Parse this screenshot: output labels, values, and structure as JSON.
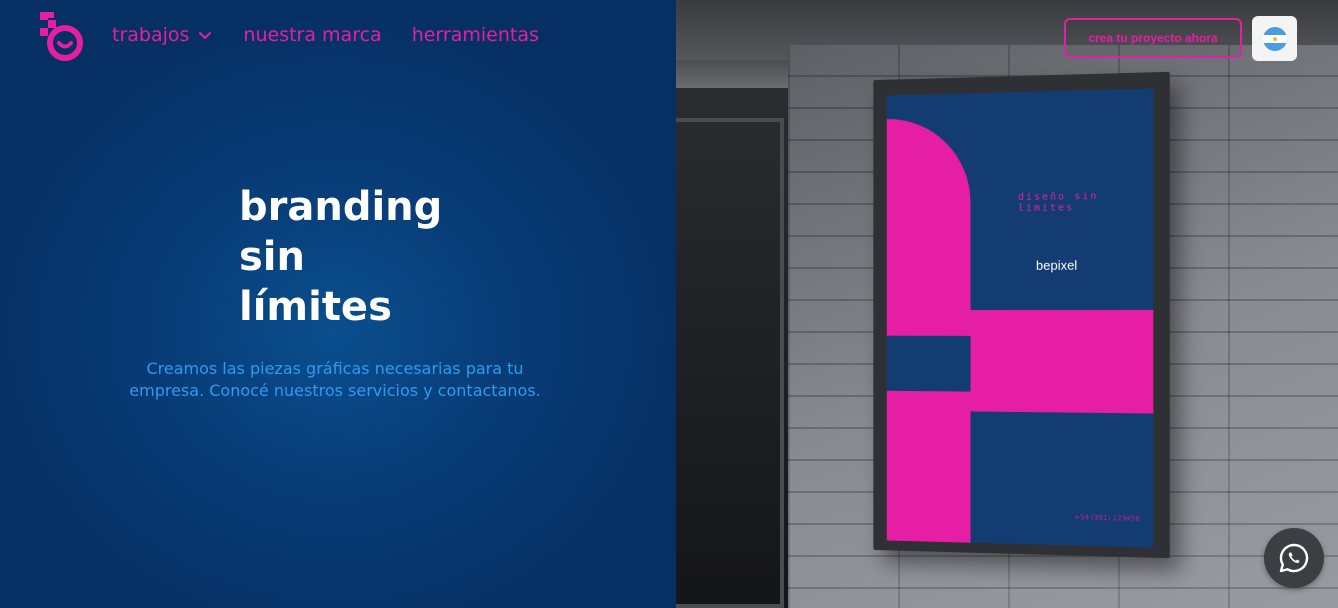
{
  "header": {
    "nav": [
      {
        "label": "trabajos",
        "has_dropdown": true
      },
      {
        "label": "nuestra marca"
      },
      {
        "label": "herramientas"
      }
    ],
    "cta_label": "crea tu proyecto ahora",
    "language_flag": "argentina-flag-icon"
  },
  "hero": {
    "title_lines": [
      "branding",
      "sin",
      "límites"
    ],
    "subtitle": "Creamos las piezas gráficas necesarias para tu empresa. Conocé nuestros servicios y contactanos."
  },
  "poster": {
    "tagline": "diseño sin límites",
    "brand": "bepixel",
    "phone": "+54 (351) 123456"
  },
  "colors": {
    "accent": "#e61ea5",
    "background": "#083d78",
    "subtitle": "#2e9af0"
  },
  "floating": {
    "whatsapp_icon": "whatsapp-icon"
  }
}
